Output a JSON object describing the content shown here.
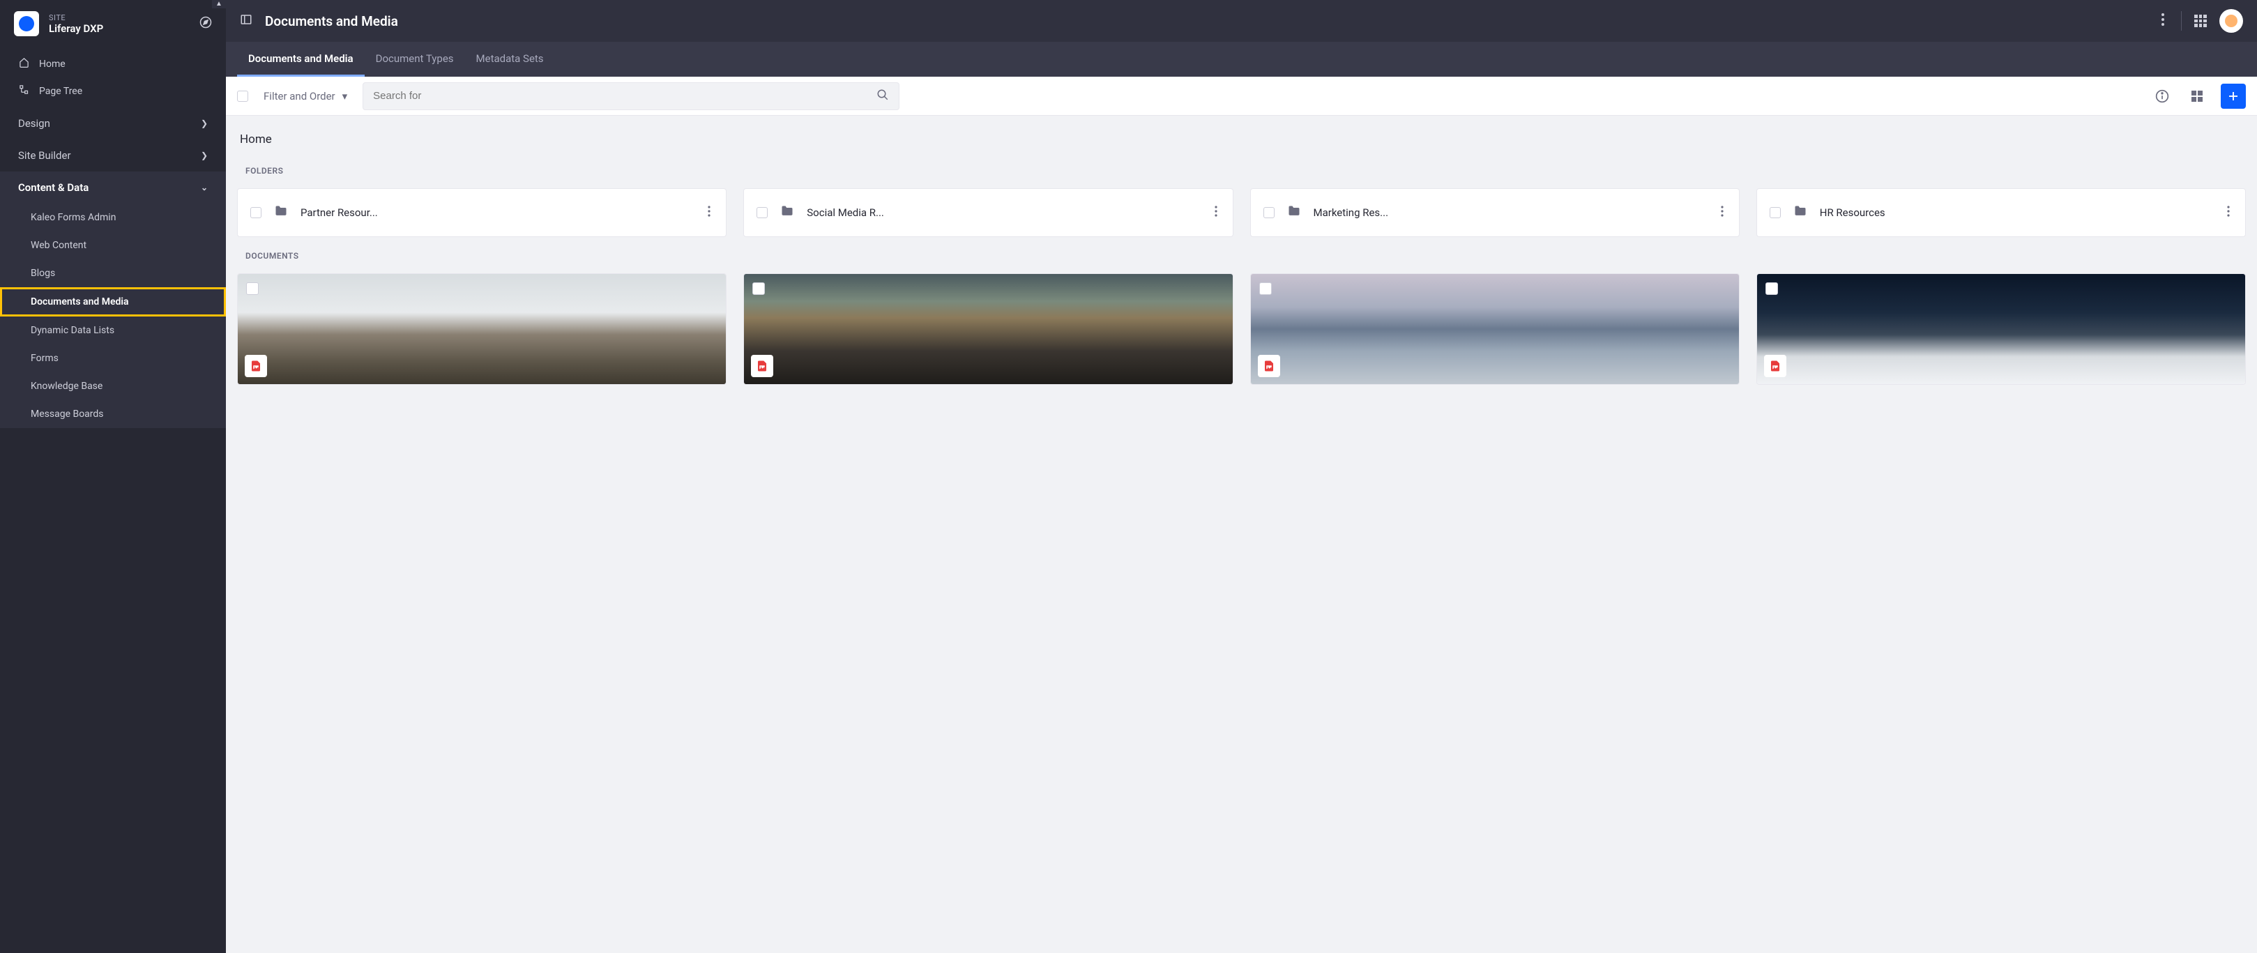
{
  "site": {
    "label": "SITE",
    "name": "Liferay DXP"
  },
  "sidebar": {
    "home": "Home",
    "page_tree": "Page Tree",
    "sections": {
      "design": "Design",
      "site_builder": "Site Builder",
      "content_data": "Content & Data"
    },
    "content_items": [
      "Kaleo Forms Admin",
      "Web Content",
      "Blogs",
      "Documents and Media",
      "Dynamic Data Lists",
      "Forms",
      "Knowledge Base",
      "Message Boards"
    ]
  },
  "header": {
    "title": "Documents and Media"
  },
  "tabs": [
    "Documents and Media",
    "Document Types",
    "Metadata Sets"
  ],
  "toolbar": {
    "filter_label": "Filter and Order",
    "search_placeholder": "Search for"
  },
  "breadcrumb": "Home",
  "labels": {
    "folders": "FOLDERS",
    "documents": "DOCUMENTS"
  },
  "folders": [
    {
      "name": "Partner Resour..."
    },
    {
      "name": "Social Media R..."
    },
    {
      "name": "Marketing Res..."
    },
    {
      "name": "HR Resources"
    }
  ],
  "documents": [
    {
      "thumb_class": "thumb-1"
    },
    {
      "thumb_class": "thumb-2"
    },
    {
      "thumb_class": "thumb-3"
    },
    {
      "thumb_class": "thumb-4"
    }
  ]
}
